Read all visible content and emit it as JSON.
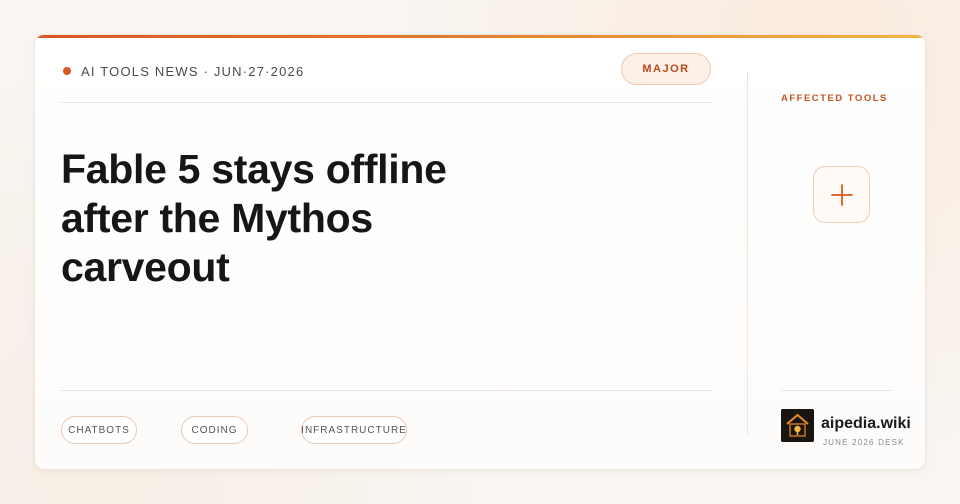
{
  "article": {
    "kicker": "AI TOOLS NEWS · JUN·27·2026",
    "severity": "MAJOR",
    "headline": "Fable 5 stays offline after the Mythos carveout",
    "tags": [
      "CHATBOTS",
      "CODING",
      "INFRASTRUCTURE"
    ]
  },
  "sidebar": {
    "title": "AFFECTED TOOLS",
    "add_icon": "plus-icon"
  },
  "brand": {
    "name": "aipedia.wiki",
    "subtitle": "JUNE 2026 DESK",
    "logo_icon": "house-logo-icon"
  },
  "colors": {
    "accent": "#d8581f",
    "accent_gradient_end": "#f2b545",
    "badge_text": "#b8481a",
    "headline": "#161616"
  }
}
